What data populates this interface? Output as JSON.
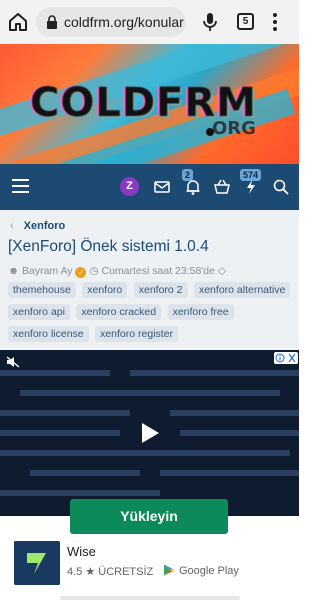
{
  "browser": {
    "url": "coldfrm.org/konular/",
    "tab_count": "5"
  },
  "banner": {
    "logo_text": "COLDFRM",
    "logo_suffix": "ORG"
  },
  "nav": {
    "avatar_letter": "Z",
    "alerts_count": "2",
    "conversations_count": "574"
  },
  "thread": {
    "breadcrumb": "Xenforo",
    "title": "[XenForo] Önek sistemi 1.0.4",
    "author": "Bayram Ay",
    "date": "Cumartesi saat 23:58'de",
    "tags": [
      "themehouse",
      "xenforo",
      "xenforo 2",
      "xenforo alternative",
      "xenforo api",
      "xenforo cracked",
      "xenforo free",
      "xenforo license",
      "xenforo register"
    ]
  },
  "ad": {
    "install_label": "Yükleyin",
    "app_name": "Wise",
    "rating": "4.5 ★ ÜCRETSİZ",
    "store_label": "Google Play"
  }
}
